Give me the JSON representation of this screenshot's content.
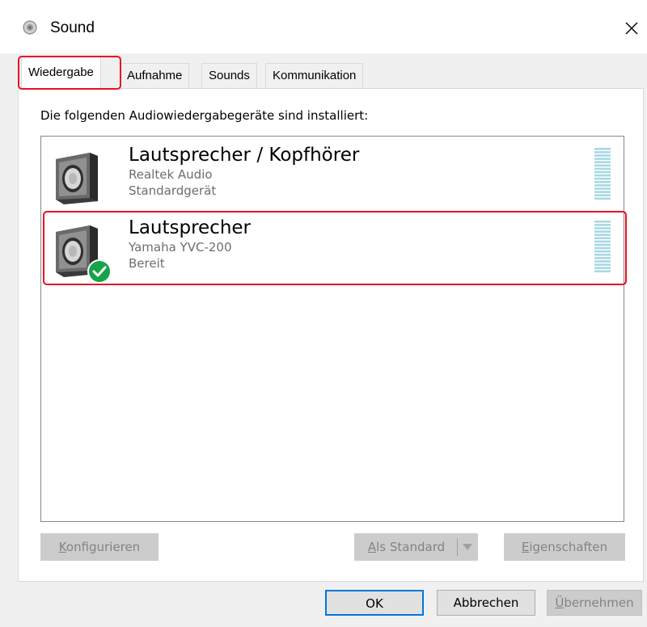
{
  "window": {
    "title": "Sound",
    "close_symbol": "✕",
    "icon": "speaker-icon"
  },
  "tabs": [
    {
      "label": "Wiedergabe",
      "active": true
    },
    {
      "label": "Aufnahme",
      "active": false
    },
    {
      "label": "Sounds",
      "active": false
    },
    {
      "label": "Kommunikation",
      "active": false
    }
  ],
  "panel": {
    "heading": "Die folgenden Audiowiedergabegeräte sind installiert:"
  },
  "devices": [
    {
      "name": "Lautsprecher / Kopfhörer",
      "driver": "Realtek Audio",
      "status": "Standardgerät",
      "is_default": false,
      "selected": false
    },
    {
      "name": "Lautsprecher",
      "driver": "Yamaha YVC-200",
      "status": "Bereit",
      "is_default": true,
      "selected": true
    }
  ],
  "buttons": {
    "configure": {
      "prefix": "",
      "accel": "K",
      "rest": "onfigurieren",
      "enabled": false
    },
    "set_default": {
      "prefix": "",
      "accel": "A",
      "rest": "ls Standard",
      "enabled": false
    },
    "properties": {
      "prefix": "",
      "accel": "E",
      "rest": "igenschaften",
      "enabled": false
    }
  },
  "footer": {
    "ok": "OK",
    "cancel": "Abbrechen",
    "apply": {
      "accel": "Ü",
      "rest": "bernehmen",
      "enabled": false
    }
  },
  "colors": {
    "highlight": "#e81123",
    "accent": "#0078d7",
    "check_green": "#16a34a",
    "meter": "#a7d8e3"
  }
}
